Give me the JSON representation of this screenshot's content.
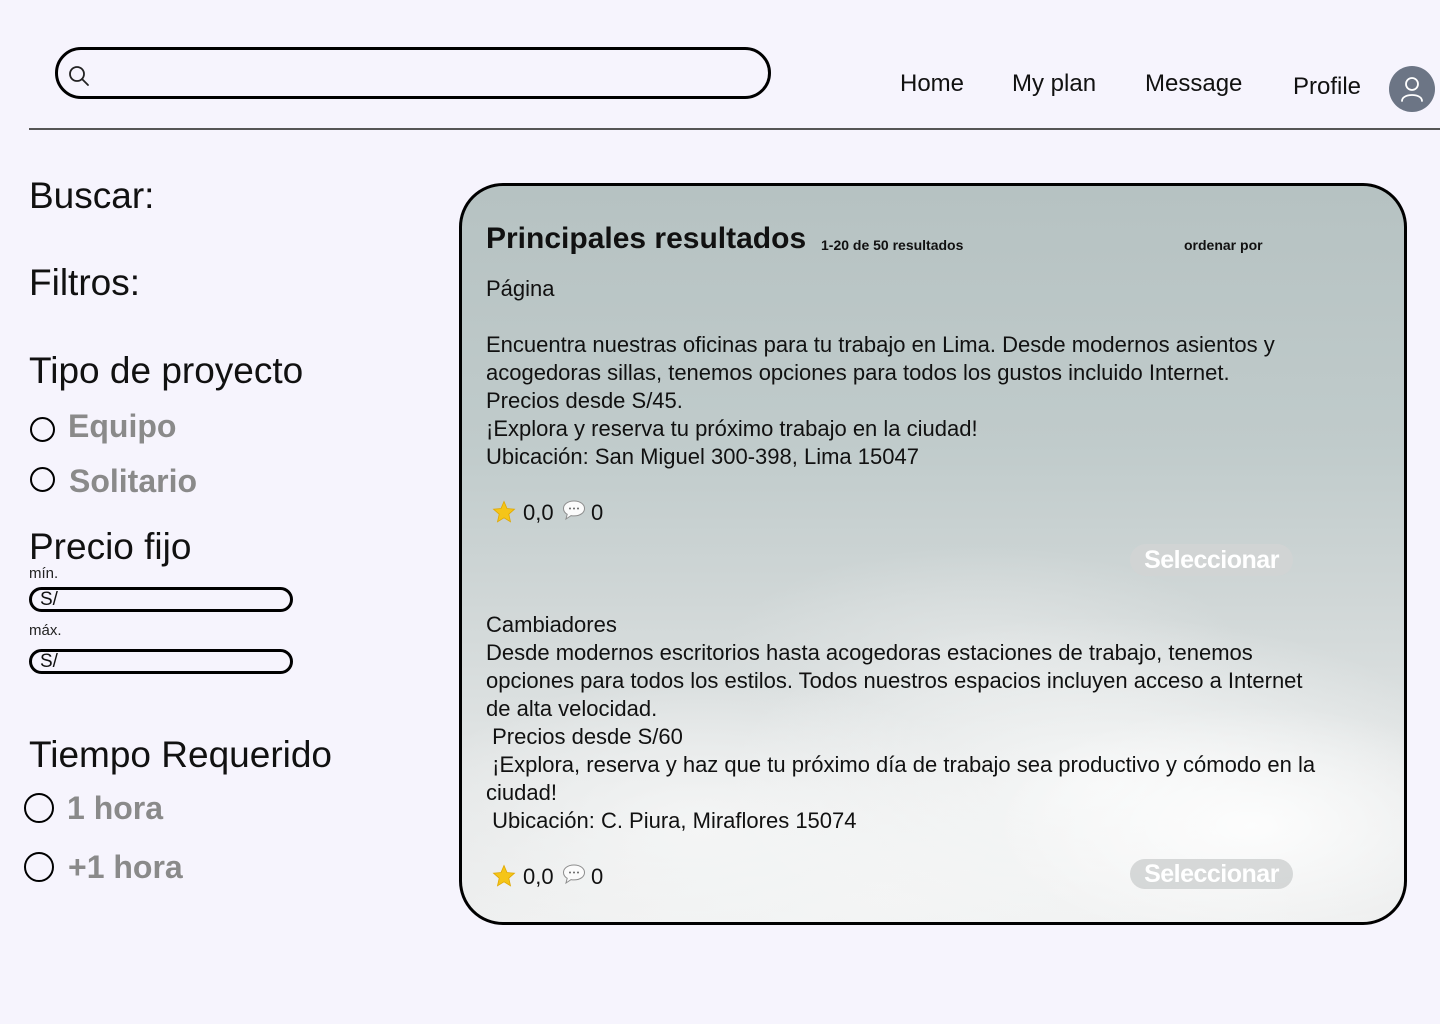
{
  "header": {
    "search": {
      "value": "",
      "placeholder": ""
    },
    "nav": {
      "home": "Home",
      "my_plan": "My plan",
      "message": "Message",
      "profile": "Profile"
    }
  },
  "sidebar": {
    "search_heading": "Buscar:",
    "filters_heading": "Filtros:",
    "project_type": {
      "heading": "Tipo de proyecto",
      "options": [
        "Equipo",
        "Solitario"
      ]
    },
    "fixed_price": {
      "heading": "Precio fijo",
      "min_label": "mín.",
      "max_label": "máx.",
      "currency_prefix": "S/"
    },
    "time_required": {
      "heading": "Tiempo Requerido",
      "options": [
        "1 hora",
        "+1 hora"
      ]
    }
  },
  "results": {
    "title": "Principales resultados",
    "count": "1-20 de 50 resultados",
    "sort_label": "ordenar por",
    "items": [
      {
        "text": "Página\n\nEncuentra nuestras oficinas para tu trabajo en Lima. Desde modernos asientos y\nacogedoras sillas, tenemos opciones para todos los gustos incluido Internet.\nPrecios desde S/45.\n¡Explora y reserva tu próximo trabajo en la ciudad!\nUbicación: San Miguel 300-398, Lima 15047",
        "rating": "0,0",
        "comments": "0",
        "button": "Seleccionar"
      },
      {
        "text": "Cambiadores\nDesde modernos escritorios hasta acogedoras estaciones de trabajo, tenemos\nopciones para todos los estilos. Todos nuestros espacios incluyen acceso a Internet\nde alta velocidad.\n Precios desde S/60\n ¡Explora, reserva y haz que tu próximo día de trabajo sea productivo y cómodo en la\nciudad!\n Ubicación: C. Piura, Miraflores 15074",
        "rating": "0,0",
        "comments": "0",
        "button": "Seleccionar"
      }
    ]
  },
  "icons": {
    "search": "search-icon",
    "avatar": "user-icon",
    "rating": "star-icon",
    "comments": "speech-bubble-icon"
  },
  "colors": {
    "page_background": "#f6f4fd",
    "avatar_background": "#6c7585",
    "muted_option_text": "#8a8a8a",
    "button_background": "#d2d4d4",
    "star": "#f5c518"
  }
}
